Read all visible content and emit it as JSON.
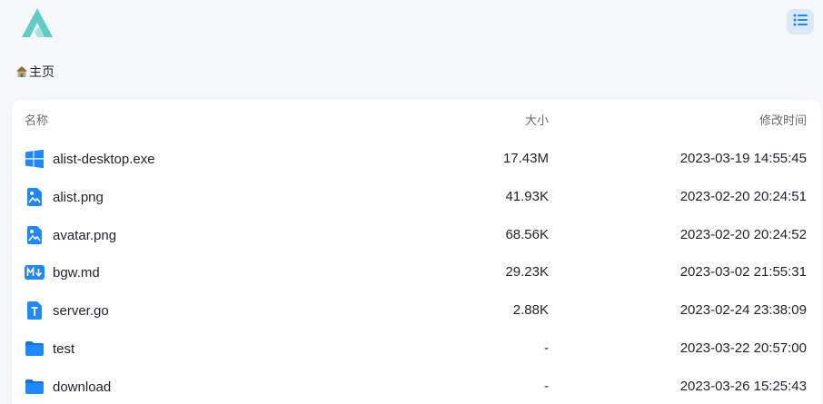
{
  "app": {
    "logo": "alist-logo",
    "menu_icon": "list-view-icon"
  },
  "breadcrumb": {
    "home_icon": "house-icon",
    "label": "主页"
  },
  "table": {
    "headers": {
      "name": "名称",
      "size": "大小",
      "modified": "修改时间"
    },
    "rows": [
      {
        "icon": "windows-icon",
        "name": "alist-desktop.exe",
        "size": "17.43M",
        "modified": "2023-03-19 14:55:45"
      },
      {
        "icon": "image-file-icon",
        "name": "alist.png",
        "size": "41.93K",
        "modified": "2023-02-20 20:24:51"
      },
      {
        "icon": "image-file-icon",
        "name": "avatar.png",
        "size": "68.56K",
        "modified": "2023-02-20 20:24:52"
      },
      {
        "icon": "markdown-icon",
        "name": "bgw.md",
        "size": "29.23K",
        "modified": "2023-03-02 21:55:31"
      },
      {
        "icon": "text-file-icon",
        "name": "server.go",
        "size": "2.88K",
        "modified": "2023-02-24 23:38:09"
      },
      {
        "icon": "folder-icon",
        "name": "test",
        "size": "-",
        "modified": "2023-03-22 20:57:00"
      },
      {
        "icon": "folder-icon",
        "name": "download",
        "size": "-",
        "modified": "2023-03-26 15:25:43"
      }
    ]
  },
  "colors": {
    "accent": "#1e88ff",
    "menu_bg": "#dbe9fb",
    "logo_teal": "#5ecdc6",
    "logo_light": "#a6e6e0"
  }
}
